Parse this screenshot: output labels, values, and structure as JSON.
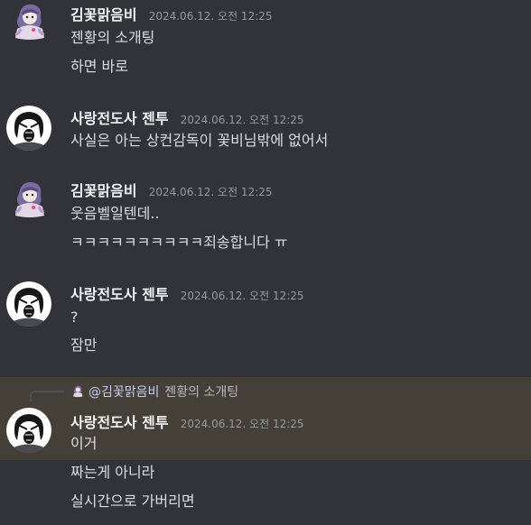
{
  "users": {
    "kim": {
      "name": "김꽃맑음비",
      "avatar": "purple-hair-avatar"
    },
    "jen": {
      "name": "사랑전도사 젠투",
      "avatar": "screaming-face-avatar"
    }
  },
  "messages": [
    {
      "author": "김꽃맑음비",
      "timestamp": "2024.06.12. 오전 12:25",
      "lines": [
        "젠황의 소개팅",
        "하면 바로"
      ]
    },
    {
      "author": "사랑전도사 젠투",
      "timestamp": "2024.06.12. 오전 12:25",
      "lines": [
        "사실은 아는 상컨감독이 꽃비님밖에 없어서"
      ]
    },
    {
      "author": "김꽃맑음비",
      "timestamp": "2024.06.12. 오전 12:25",
      "lines": [
        "웃음벨일텐데..",
        "ㅋㅋㅋㅋㅋㅋㅋㅋㅋㅋ죄송합니다 ㅠ"
      ]
    },
    {
      "author": "사랑전도사 젠투",
      "timestamp": "2024.06.12. 오전 12:25",
      "lines": [
        "?",
        "잠만"
      ]
    },
    {
      "author": "사랑전도사 젠투",
      "timestamp": "2024.06.12. 오전 12:25",
      "reply": {
        "mention": "@김꽃맑음비",
        "text": "젠황의 소개팅"
      },
      "lines": [
        "이거",
        "짜는게 아니라",
        "실시간으로 가버리면"
      ]
    }
  ],
  "colors": {
    "background": "#323339",
    "highlight": "#444037",
    "username": "#f2f3f5",
    "timestamp": "#949ba4",
    "text": "#dbdee1"
  }
}
